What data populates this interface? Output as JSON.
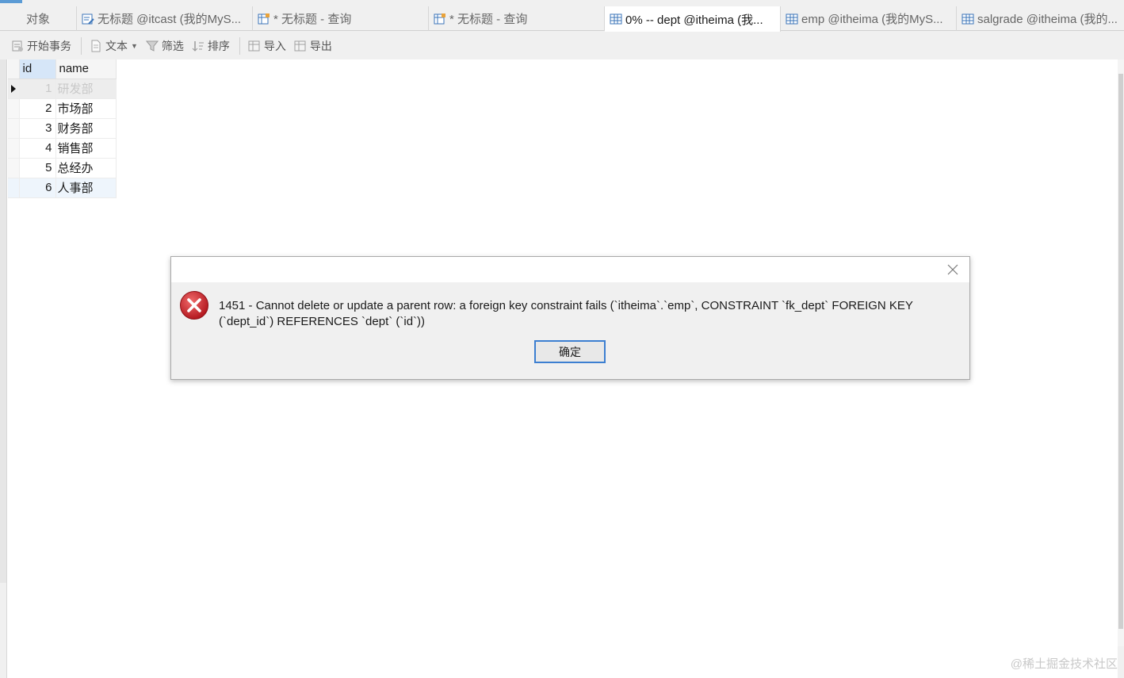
{
  "tabs": [
    {
      "label": "对象",
      "icon": "none",
      "active": false
    },
    {
      "label": "无标题 @itcast (我的MyS...",
      "icon": "query-edit-icon",
      "active": false
    },
    {
      "label": "* 无标题 - 查询",
      "icon": "query-icon",
      "active": false
    },
    {
      "label": "* 无标题 - 查询",
      "icon": "query-icon",
      "active": false
    },
    {
      "label": "0% -- dept @itheima (我...",
      "icon": "table-icon",
      "active": true
    },
    {
      "label": "emp @itheima (我的MyS...",
      "icon": "table-icon",
      "active": false
    },
    {
      "label": "salgrade @itheima (我的...",
      "icon": "table-icon",
      "active": false
    }
  ],
  "toolbar": {
    "begin_transaction": "开始事务",
    "text": "文本",
    "filter": "筛选",
    "sort": "排序",
    "import": "导入",
    "export": "导出"
  },
  "grid": {
    "columns": [
      "id",
      "name"
    ],
    "rows": [
      {
        "id": "1",
        "name": "研发部"
      },
      {
        "id": "2",
        "name": "市场部"
      },
      {
        "id": "3",
        "name": "财务部"
      },
      {
        "id": "4",
        "name": "销售部"
      },
      {
        "id": "5",
        "name": "总经办"
      },
      {
        "id": "6",
        "name": "人事部"
      }
    ]
  },
  "dialog": {
    "message": "1451 - Cannot delete or update a parent row: a foreign key constraint fails (`itheima`.`emp`, CONSTRAINT `fk_dept` FOREIGN KEY (`dept_id`) REFERENCES `dept` (`id`))",
    "ok_label": "确定"
  },
  "watermark": "@稀土掘金技术社区",
  "colors": {
    "accent": "#3c7fd1",
    "error_red": "#c0262d",
    "selected_header": "#d6e6f8"
  }
}
